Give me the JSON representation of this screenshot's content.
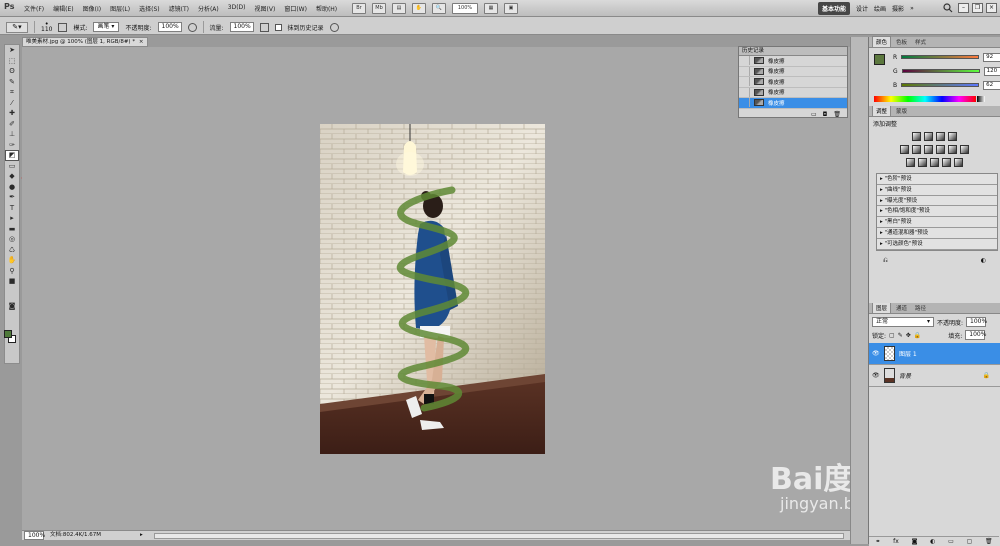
{
  "app": {
    "logo": "Ps"
  },
  "menu": [
    "文件(F)",
    "编辑(E)",
    "图像(I)",
    "图层(L)",
    "选择(S)",
    "滤镜(T)",
    "分析(A)",
    "3D(D)",
    "视图(V)",
    "窗口(W)",
    "帮助(H)"
  ],
  "toolbar_top": {
    "zoom": "100%"
  },
  "workspaces": {
    "active": "基本功能",
    "items": [
      "设计",
      "绘画",
      "摄影"
    ],
    "more": "»"
  },
  "options": {
    "brush_size": "110",
    "mode_label": "模式:",
    "mode_value": "画笔",
    "opacity_label": "不透明度:",
    "opacity_value": "100%",
    "flow_label": "流量:",
    "flow_value": "100%",
    "erase_history_label": "抹到历史记录"
  },
  "document": {
    "tab_title": "唯美素材.jpg @ 100% (图层 1, RGB/8#) *",
    "zoom": "100%",
    "doc_info": "文档:802.4K/1.67M"
  },
  "history": {
    "title": "历史记录",
    "items": [
      {
        "label": "橡皮擦",
        "selected": false
      },
      {
        "label": "橡皮擦",
        "selected": false
      },
      {
        "label": "橡皮擦",
        "selected": false
      },
      {
        "label": "橡皮擦",
        "selected": false
      },
      {
        "label": "橡皮擦",
        "selected": true
      }
    ]
  },
  "color_panel": {
    "tabs": [
      "颜色",
      "色板",
      "样式"
    ],
    "r": "92",
    "g": "120",
    "b": "62",
    "r_label": "R",
    "g_label": "G",
    "b_label": "B",
    "foreground": "#5c783e"
  },
  "adjustments": {
    "tabs": [
      "调整",
      "蒙版"
    ],
    "heading": "添加调整",
    "presets": [
      "\"色阶\"预设",
      "\"曲线\"预设",
      "\"曝光度\"预设",
      "\"色相/饱和度\"预设",
      "\"黑白\"预设",
      "\"通道混和器\"预设",
      "\"可选颜色\"预设"
    ]
  },
  "layers": {
    "tabs": [
      "图层",
      "通道",
      "路径"
    ],
    "blend_mode": "正常",
    "opacity_label": "不透明度:",
    "opacity_value": "100%",
    "lock_label": "锁定:",
    "fill_label": "填充:",
    "fill_value": "100%",
    "items": [
      {
        "name": "图层 1",
        "selected": true
      },
      {
        "name": "背景",
        "selected": false
      }
    ]
  },
  "watermark": {
    "brand": "Bai度经验",
    "url": "jingyan.baidu.com"
  }
}
